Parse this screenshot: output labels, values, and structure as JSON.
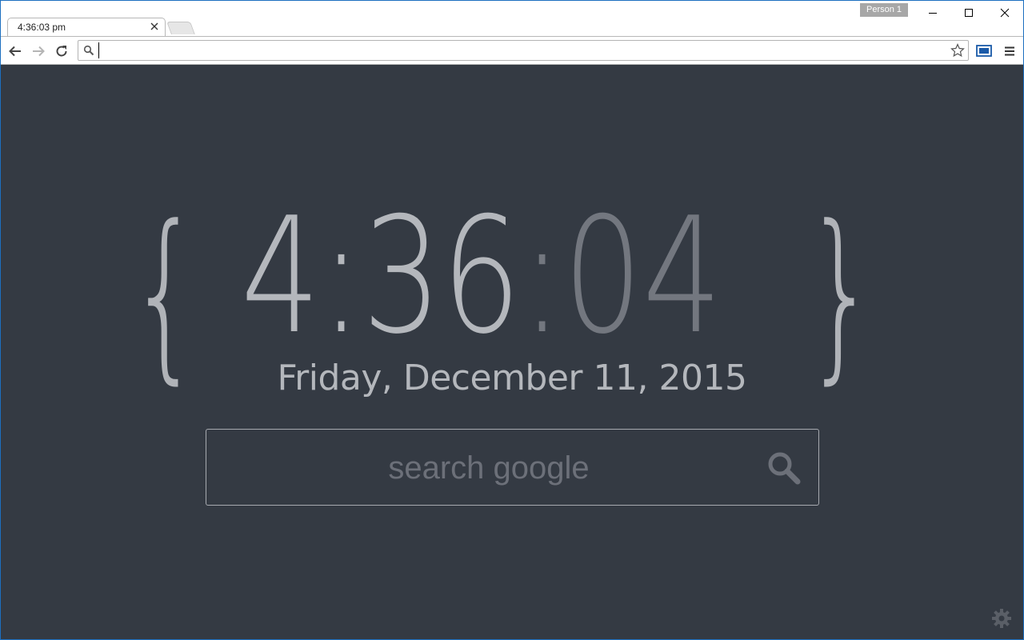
{
  "browser": {
    "tab": {
      "title": "4:36:03 pm"
    },
    "profile": {
      "label": "Person 1"
    },
    "omnibox": {
      "value": ""
    }
  },
  "page": {
    "clock": {
      "brace_open": "{",
      "brace_close": "}",
      "hours_minutes": "4:36",
      "separator": ":",
      "seconds": "04"
    },
    "date": "Friday, December 11, 2015",
    "search": {
      "placeholder": "search google"
    }
  },
  "icons": {
    "tab_close": "close-icon",
    "back": "arrow-left-icon",
    "forward": "arrow-right-icon",
    "reload": "reload-icon",
    "omnibox_search": "search-icon",
    "bookmark": "star-icon",
    "cast": "cast-icon",
    "menu": "hamburger-menu-icon",
    "search": "search-icon",
    "settings": "gear-icon"
  },
  "colors": {
    "page_background": "#343a43",
    "clock_primary": "#b4b7bc",
    "clock_seconds": "#73777f",
    "placeholder": "#6c7079",
    "window_border": "#1d6fc0"
  }
}
